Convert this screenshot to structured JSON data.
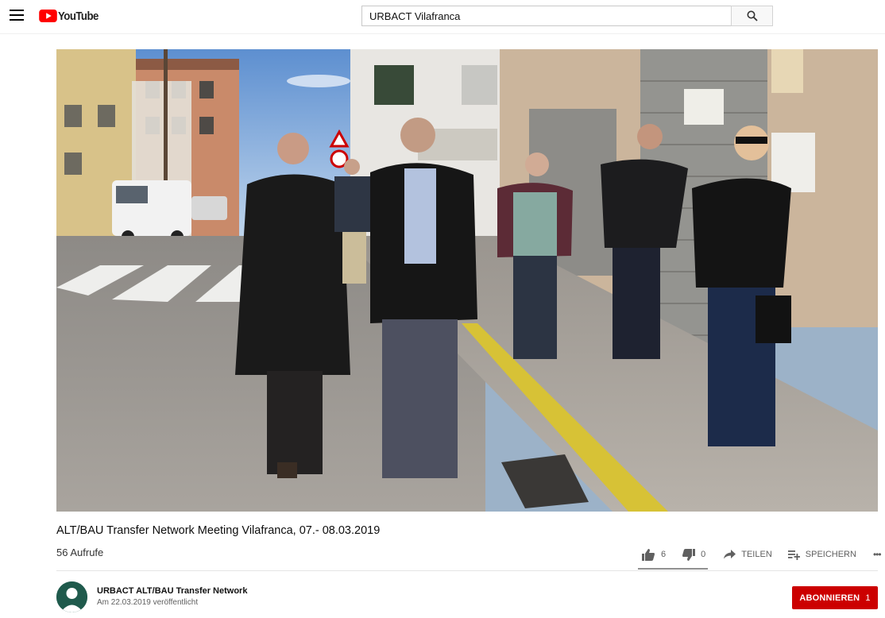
{
  "header": {
    "logo_text": "YouTube",
    "search_value": "URBACT Vilafranca"
  },
  "video": {
    "title": "ALT/BAU Transfer Network Meeting Vilafranca, 07.- 08.03.2019",
    "views": "56 Aufrufe",
    "likes": "6",
    "dislikes": "0",
    "share_label": "TEILEN",
    "save_label": "SPEICHERN",
    "more_label": "•••"
  },
  "channel": {
    "name": "URBACT ALT/BAU Transfer Network",
    "published": "Am 22.03.2019 veröffentlicht",
    "subscribe_label": "ABONNIEREN",
    "subscriber_count": "1"
  },
  "colors": {
    "brand_red": "#ff0000",
    "subscribe_red": "#cc0000",
    "icon_gray": "#606060"
  },
  "icons": [
    "menu-icon",
    "youtube-logo-icon",
    "search-icon",
    "thumbs-up-icon",
    "thumbs-down-icon",
    "share-icon",
    "playlist-add-icon",
    "more-icon"
  ]
}
